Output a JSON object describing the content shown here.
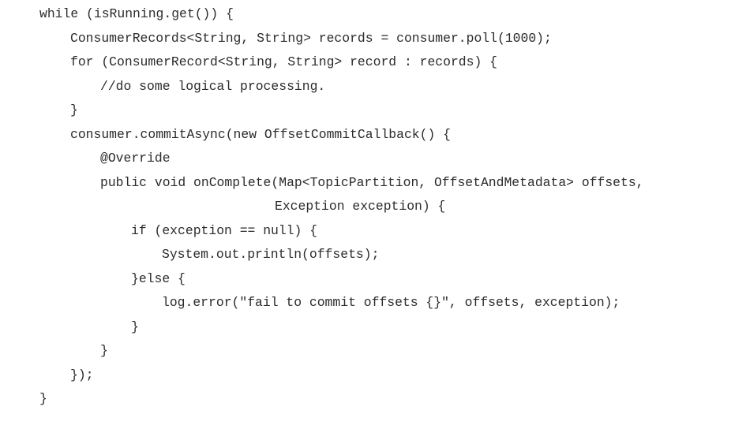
{
  "code": {
    "lines": [
      "while (isRunning.get()) {",
      "ConsumerRecords<String, String> records = consumer.poll(1000);",
      "for (ConsumerRecord<String, String> record : records) {",
      "//do some logical processing.",
      "}",
      "consumer.commitAsync(new OffsetCommitCallback() {",
      "@Override",
      "public void onComplete(Map<TopicPartition, OffsetAndMetadata> offsets,",
      "Exception exception) {",
      "if (exception == null) {",
      "System.out.println(offsets);",
      "}else {",
      "log.error(\"fail to commit offsets {}\", offsets, exception);",
      "}",
      "}",
      "});",
      "}"
    ]
  }
}
